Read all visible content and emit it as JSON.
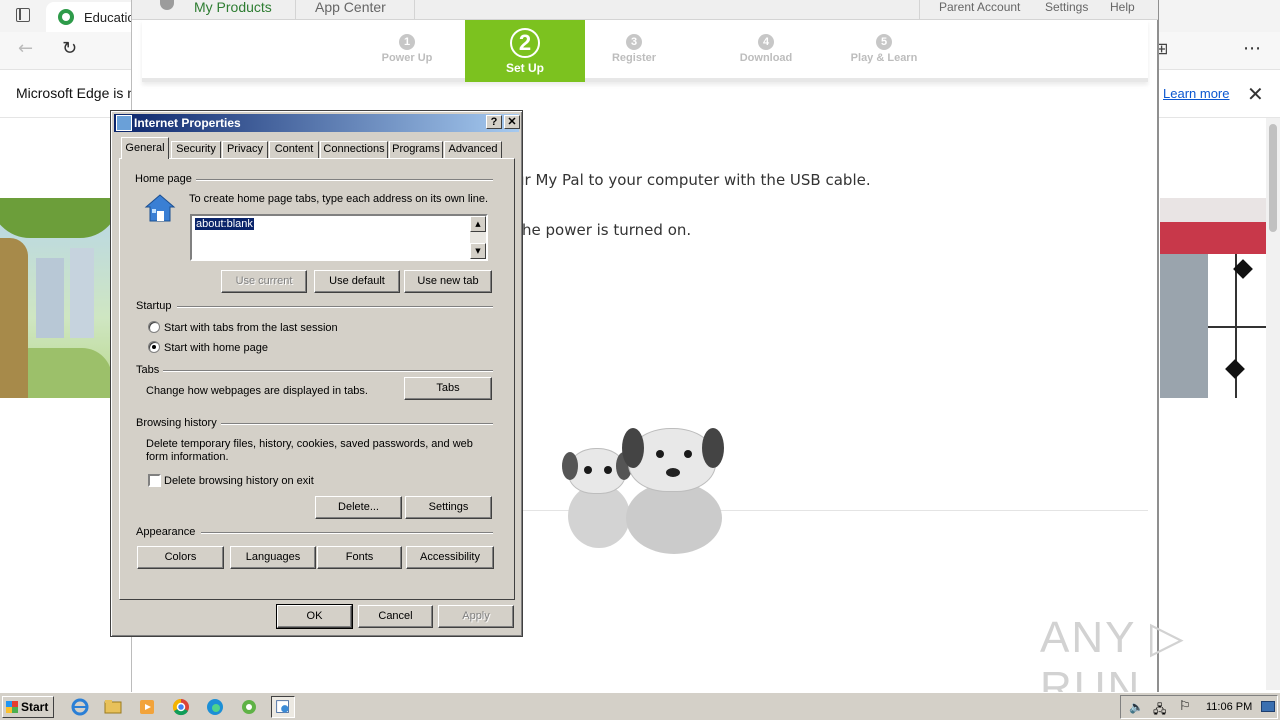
{
  "edge": {
    "tab_title": "Educatio",
    "infobar_text": "Microsoft Edge is n",
    "learn_more": "Learn more"
  },
  "leapfrog": {
    "nav_tabs": [
      "My Products",
      "App Center"
    ],
    "top_links": [
      "Parent Account",
      "Settings",
      "Help"
    ],
    "steps": [
      {
        "num": "1",
        "label": "Power Up",
        "state": "done"
      },
      {
        "num": "2",
        "label": "Set Up",
        "state": "active"
      },
      {
        "num": "3",
        "label": "Register",
        "state": "pending"
      },
      {
        "num": "4",
        "label": "Download",
        "state": "pending"
      },
      {
        "num": "5",
        "label": "Play & Learn",
        "state": "pending"
      }
    ],
    "instructions": [
      "ur My Pal to your computer with the USB cable.",
      "he power is turned on."
    ],
    "accent_color": "#7cc21f"
  },
  "dialog": {
    "title": "Internet Properties",
    "title_buttons": [
      "?",
      "✕"
    ],
    "tabs": [
      "General",
      "Security",
      "Privacy",
      "Content",
      "Connections",
      "Programs",
      "Advanced"
    ],
    "active_tab": "General",
    "home_page": {
      "group_label": "Home page",
      "hint": "To create home page tabs, type each address on its own line.",
      "value": "about:blank",
      "buttons": [
        "Use current",
        "Use default",
        "Use new tab"
      ]
    },
    "startup": {
      "group_label": "Startup",
      "options": [
        "Start with tabs from the last session",
        "Start with home page"
      ],
      "selected": "Start with home page"
    },
    "tabs_group": {
      "group_label": "Tabs",
      "description": "Change how webpages are displayed in tabs.",
      "button": "Tabs"
    },
    "browsing_history": {
      "group_label": "Browsing history",
      "description_line1": "Delete temporary files, history, cookies, saved passwords, and web",
      "description_line2": "form information.",
      "checkbox_label": "Delete browsing history on exit",
      "checked": false,
      "buttons": [
        "Delete...",
        "Settings"
      ]
    },
    "appearance": {
      "group_label": "Appearance",
      "buttons": [
        "Colors",
        "Languages",
        "Fonts",
        "Accessibility"
      ]
    },
    "footer_buttons": [
      "OK",
      "Cancel",
      "Apply"
    ]
  },
  "taskbar": {
    "start_label": "Start",
    "apps": [
      "internet-explorer-icon",
      "folder-icon",
      "media-player-icon",
      "chrome-icon",
      "edge-icon",
      "leapfrog-icon",
      "internet-properties-icon"
    ],
    "clock": "11:06 PM"
  },
  "watermark": "ANY ▷ RUN"
}
